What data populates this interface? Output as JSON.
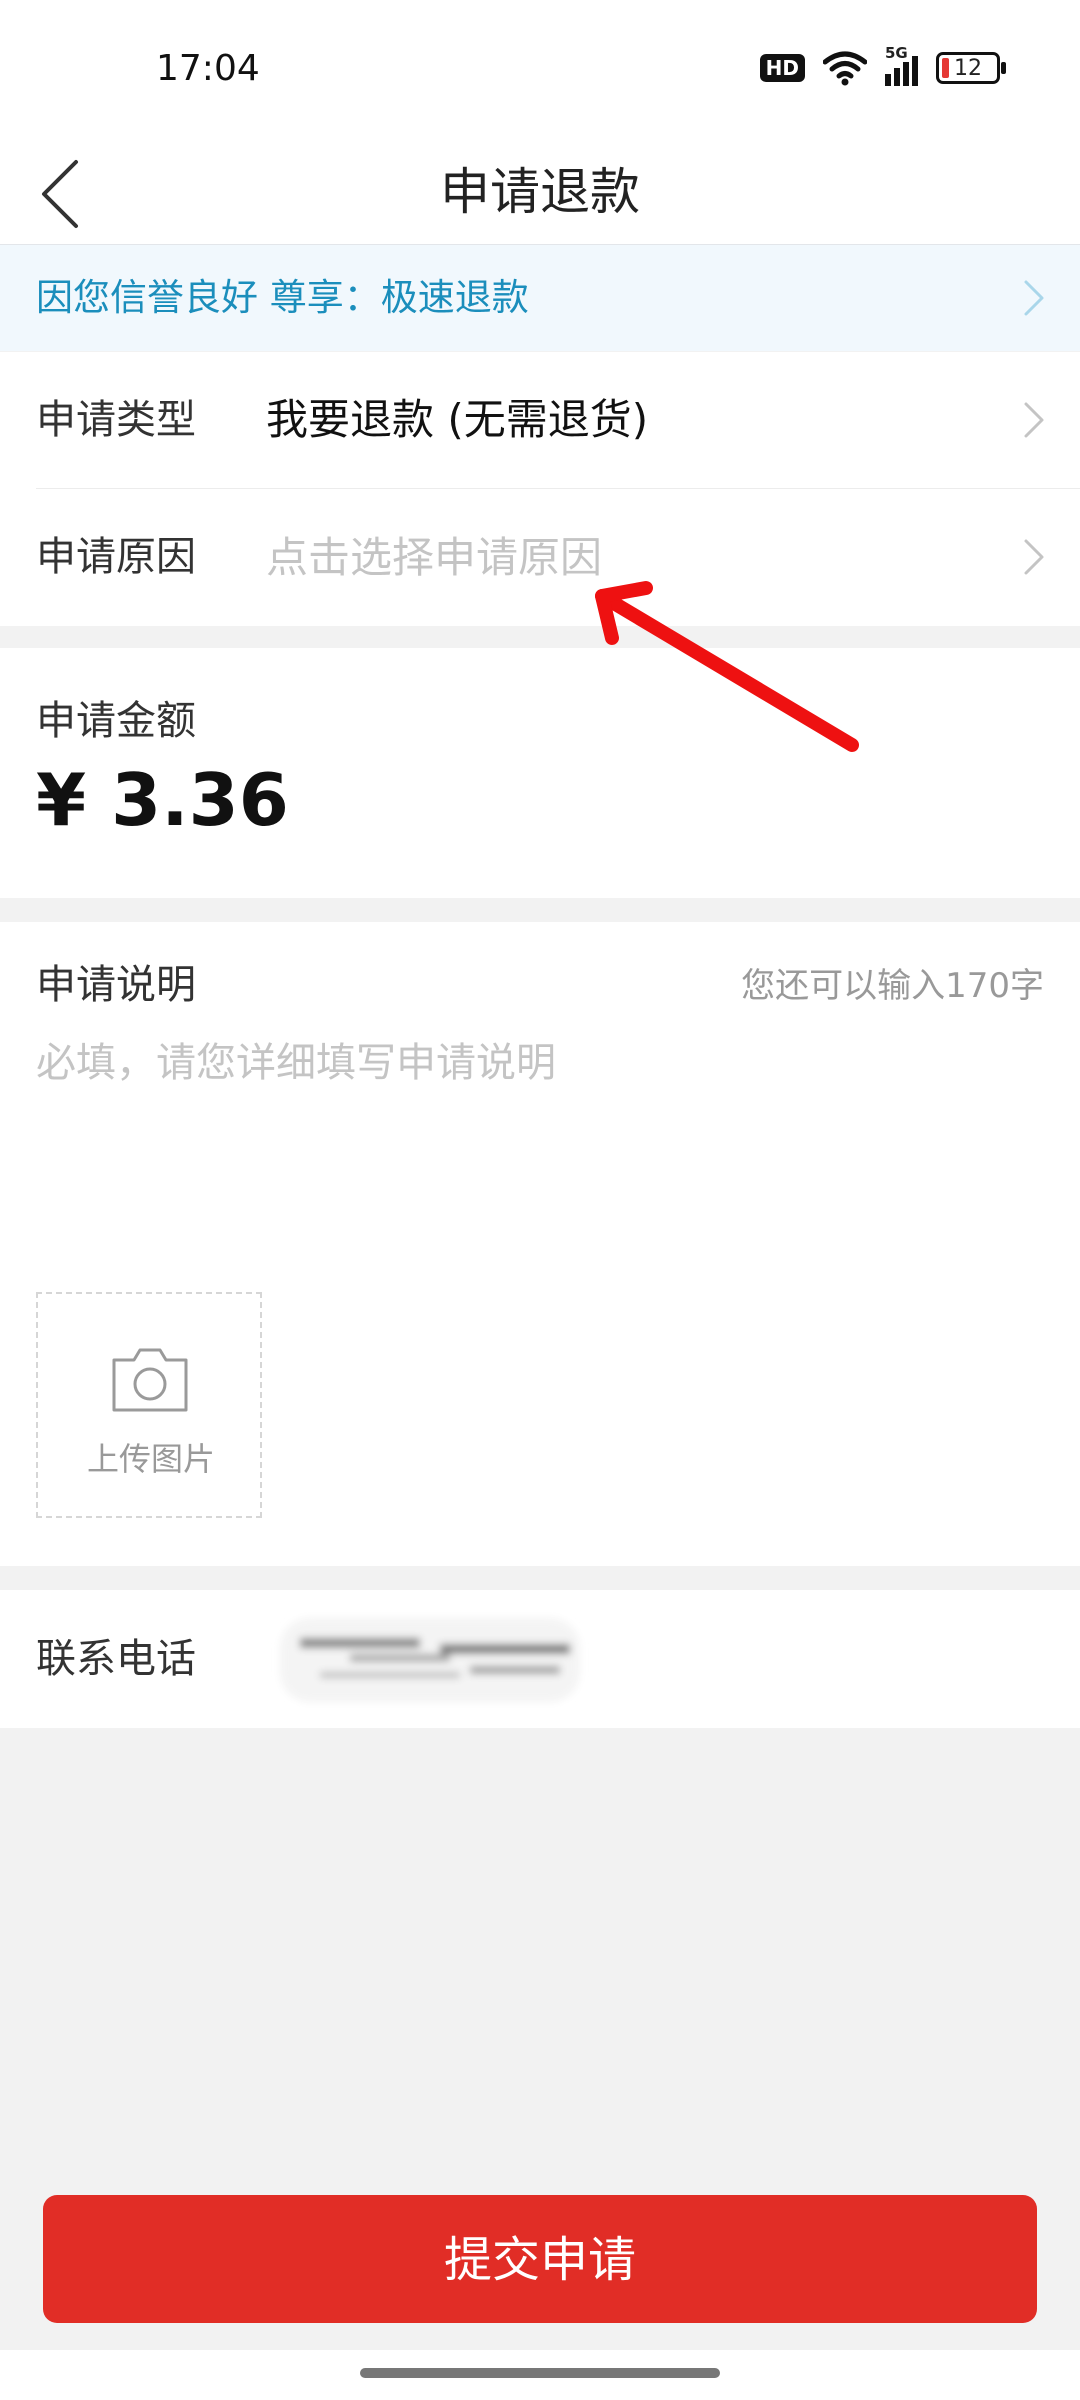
{
  "status_bar": {
    "time": "17:04",
    "hd": "HD",
    "network": "5G",
    "battery": "12"
  },
  "header": {
    "title": "申请退款"
  },
  "promo": {
    "text": "因您信誉良好 尊享：极速退款"
  },
  "form": {
    "type": {
      "label": "申请类型",
      "value": "我要退款 (无需退货)"
    },
    "reason": {
      "label": "申请原因",
      "placeholder": "点击选择申请原因"
    }
  },
  "amount": {
    "label": "申请金额",
    "value": "¥ 3.36"
  },
  "description": {
    "label": "申请说明",
    "counter": "您还可以输入170字",
    "placeholder": "必填，请您详细填写申请说明"
  },
  "upload": {
    "label": "上传图片"
  },
  "contact": {
    "label": "联系电话",
    "value": ""
  },
  "submit": {
    "label": "提交申请"
  },
  "colors": {
    "accent": "#e12d26",
    "promo_text": "#1b8ebc",
    "promo_bg": "#f1f8fd",
    "annotation": "#ee1111"
  }
}
